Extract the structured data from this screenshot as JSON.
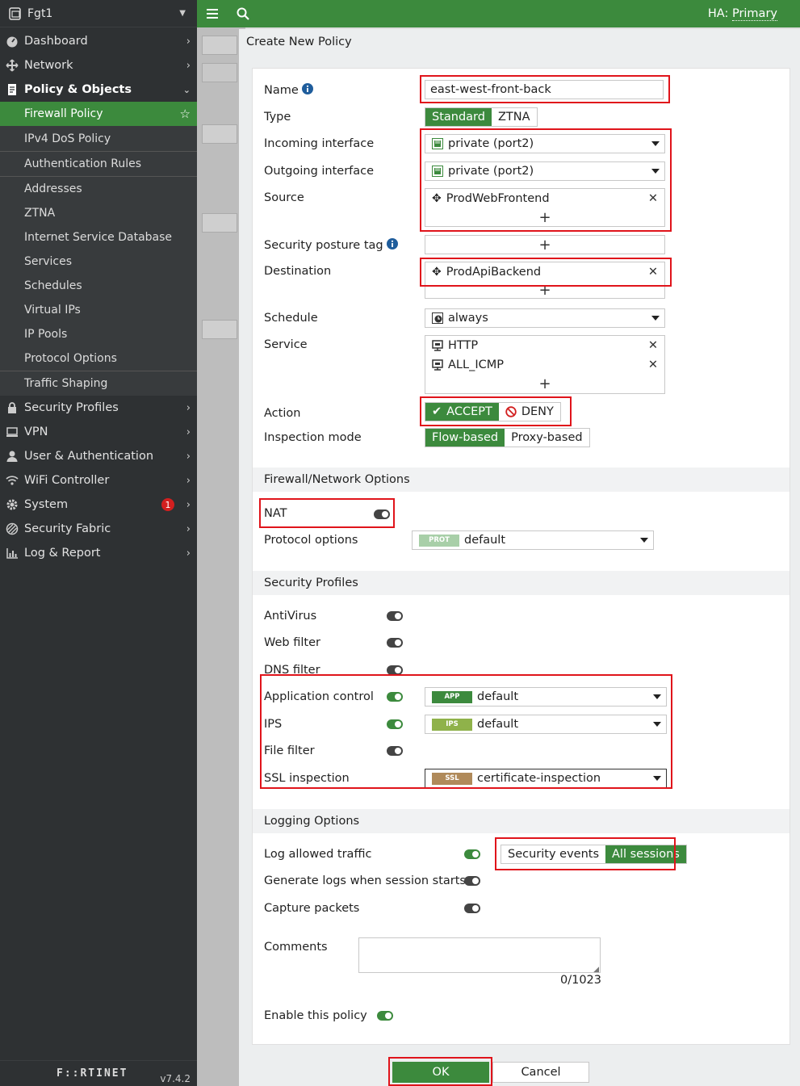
{
  "sidebar": {
    "device_name": "Fgt1",
    "items": [
      {
        "label": "Dashboard",
        "icon": "dashboard-icon"
      },
      {
        "label": "Network",
        "icon": "network-icon"
      },
      {
        "label": "Policy & Objects",
        "icon": "policy-icon"
      }
    ],
    "sub_items": [
      "Firewall Policy",
      "IPv4 DoS Policy",
      "Authentication Rules",
      "Addresses",
      "ZTNA",
      "Internet Service Database",
      "Services",
      "Schedules",
      "Virtual IPs",
      "IP Pools",
      "Protocol Options",
      "Traffic Shaping"
    ],
    "items_after": [
      {
        "label": "Security Profiles",
        "icon": "lock-icon"
      },
      {
        "label": "VPN",
        "icon": "vpn-icon"
      },
      {
        "label": "User & Authentication",
        "icon": "user-icon"
      },
      {
        "label": "WiFi Controller",
        "icon": "wifi-icon"
      },
      {
        "label": "System",
        "icon": "gear-icon",
        "badge": "1"
      },
      {
        "label": "Security Fabric",
        "icon": "fabric-icon"
      },
      {
        "label": "Log & Report",
        "icon": "chart-icon"
      }
    ],
    "logo": "F::RTINET",
    "version": "v7.4.2"
  },
  "header": {
    "ha_label": "HA:",
    "ha_value": "Primary"
  },
  "dialog": {
    "title": "Create New Policy",
    "name_label": "Name",
    "name_value": "east-west-front-back",
    "type_label": "Type",
    "type_options": [
      "Standard",
      "ZTNA"
    ],
    "incoming_label": "Incoming interface",
    "incoming_value": "private (port2)",
    "outgoing_label": "Outgoing interface",
    "outgoing_value": "private (port2)",
    "source_label": "Source",
    "source_value": "ProdWebFrontend",
    "posture_label": "Security posture tag",
    "destination_label": "Destination",
    "destination_value": "ProdApiBackend",
    "schedule_label": "Schedule",
    "schedule_value": "always",
    "service_label": "Service",
    "services": [
      "HTTP",
      "ALL_ICMP"
    ],
    "action_label": "Action",
    "action_accept": "ACCEPT",
    "action_deny": "DENY",
    "inspection_label": "Inspection mode",
    "inspection_options": [
      "Flow-based",
      "Proxy-based"
    ],
    "section_network": "Firewall/Network Options",
    "nat_label": "NAT",
    "protocol_label": "Protocol options",
    "protocol_tag": "PROT",
    "protocol_value": "default",
    "section_profiles": "Security Profiles",
    "antivirus_label": "AntiVirus",
    "webfilter_label": "Web filter",
    "dnsfilter_label": "DNS filter",
    "appctrl_label": "Application control",
    "appctrl_tag": "APP",
    "appctrl_value": "default",
    "ips_label": "IPS",
    "ips_tag": "IPS",
    "ips_value": "default",
    "filefilter_label": "File filter",
    "ssl_label": "SSL inspection",
    "ssl_tag": "SSL",
    "ssl_value": "certificate-inspection",
    "section_logging": "Logging Options",
    "log_allowed_label": "Log allowed traffic",
    "log_options": [
      "Security events",
      "All sessions"
    ],
    "gen_logs_label": "Generate logs when session starts",
    "capture_label": "Capture packets",
    "comments_label": "Comments",
    "comments_counter": "0/1023",
    "enable_label": "Enable this policy",
    "ok_label": "OK",
    "cancel_label": "Cancel"
  }
}
